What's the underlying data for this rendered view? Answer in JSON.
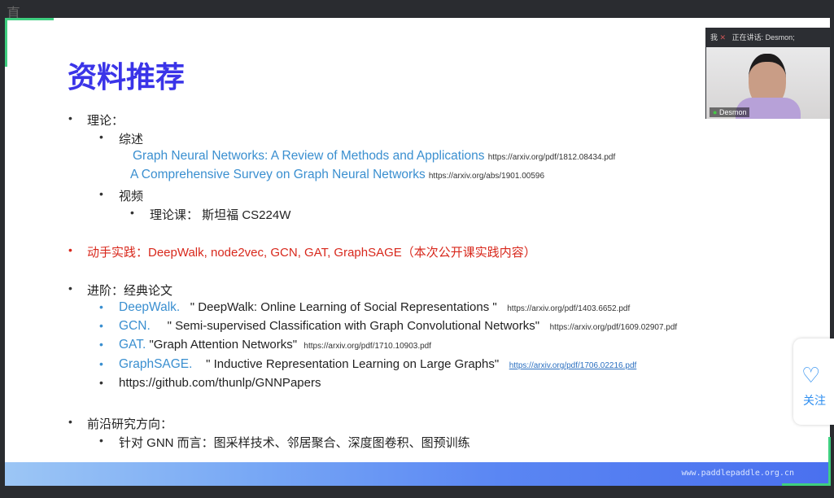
{
  "topbar": {
    "text": "直"
  },
  "slide": {
    "title": "资料推荐",
    "theory": "理论：",
    "review": "综述",
    "papers": [
      {
        "title": "Graph Neural Networks: A Review of Methods and Applications",
        "url": "https://arxiv.org/pdf/1812.08434.pdf"
      },
      {
        "title": "A Comprehensive Survey on Graph Neural Networks",
        "url": "https://arxiv.org/abs/1901.00596"
      }
    ],
    "video": "视频",
    "course": "理论课： 斯坦福 CS224W",
    "practice": "动手实践：DeepWalk, node2vec, GCN, GAT, GraphSAGE（本次公开课实践内容）",
    "advanced": "进阶：经典论文",
    "classics": [
      {
        "name": "DeepWalk.",
        "title": "\" DeepWalk: Online Learning of Social Representations \"",
        "url": "https://arxiv.org/pdf/1403.6652.pdf"
      },
      {
        "name": "GCN.",
        "title": "\" Semi-supervised Classification with Graph Convolutional Networks\"",
        "url": "https://arxiv.org/pdf/1609.02907.pdf"
      },
      {
        "name": "GAT.",
        "title": "\"Graph Attention Networks\"",
        "url": "https://arxiv.org/pdf/1710.10903.pdf"
      },
      {
        "name": "GraphSAGE.",
        "title": "\" Inductive Representation Learning on Large Graphs\"",
        "url": "https://arxiv.org/pdf/1706.02216.pdf"
      }
    ],
    "github": "https://github.com/thunlp/GNNPapers",
    "frontier": "前沿研究方向：",
    "frontier_item": "针对 GNN 而言：图采样技术、邻居聚合、深度图卷积、图预训练",
    "footer": "www.paddlepaddle.org.cn"
  },
  "video": {
    "me": "我",
    "speaking": "正在讲话: Desmon;",
    "name": "Desmon"
  },
  "follow": {
    "label": "关注"
  }
}
